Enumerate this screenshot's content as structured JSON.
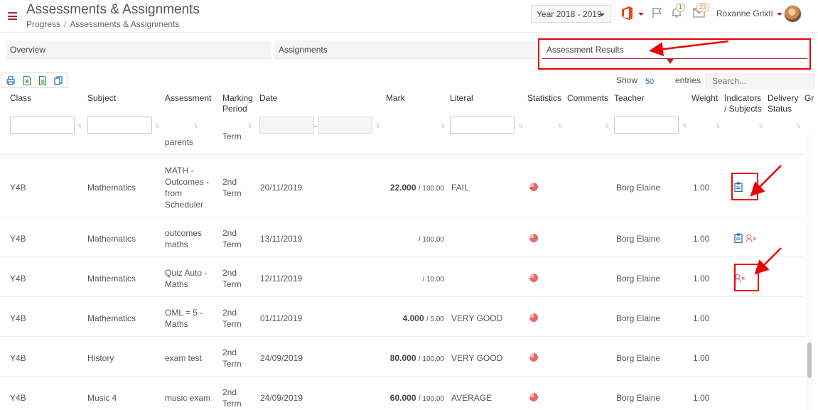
{
  "header": {
    "title": "Assessments & Assignments",
    "breadcrumb": [
      "Progress",
      "Assessments & Assignments"
    ],
    "year_select": "Year 2018 - 2019",
    "notifications_count": "1",
    "messages_count": "22",
    "user_name": "Roxanne Grixti",
    "brand_color": "#b7222b"
  },
  "tabs": [
    {
      "label": "Overview"
    },
    {
      "label": "Assignments"
    },
    {
      "label": "Assessment Results",
      "active": true
    }
  ],
  "toolbar": {
    "export_icons": [
      "print-icon",
      "excel-icon",
      "csv-icon",
      "copy-icon"
    ],
    "show_label": "Show",
    "show_value": "50",
    "entries_label": "entries",
    "search_placeholder": "Search..."
  },
  "columns": [
    "Class",
    "Subject",
    "Assessment",
    "Marking Period",
    "Date",
    "Mark",
    "Literal",
    "Statistics",
    "Comments",
    "Teacher",
    "Weight",
    "Indicators / Subjects",
    "Delivery Status",
    "Gr"
  ],
  "partial_row": {
    "assessment": "parents",
    "period": "Term"
  },
  "rows": [
    {
      "class": "Y4B",
      "subject": "Mathematics",
      "assessment": [
        "MATH -",
        "Outcomes -",
        "from",
        "Scheduler"
      ],
      "period": [
        "2nd",
        "Term"
      ],
      "date": "20/11/2019",
      "mark": "22.000",
      "mark_total": "/ 100.00",
      "literal": "FAIL",
      "teacher": "Borg Elaine",
      "weight": "1.00",
      "indicators": [
        "clipboard-icon"
      ]
    },
    {
      "class": "Y4B",
      "subject": "Mathematics",
      "assessment": [
        "outcomes",
        "maths"
      ],
      "period": [
        "2nd",
        "Term"
      ],
      "date": "13/11/2019",
      "mark": "",
      "mark_total": "/ 100.00",
      "literal": "",
      "teacher": "Borg Elaine",
      "weight": "1.00",
      "indicators": [
        "clipboard-icon",
        "user-x-icon"
      ]
    },
    {
      "class": "Y4B",
      "subject": "Mathematics",
      "assessment": [
        "Quiz Auto -",
        "Maths"
      ],
      "period": [
        "2nd",
        "Term"
      ],
      "date": "12/11/2019",
      "mark": "",
      "mark_total": "/ 10.00",
      "literal": "",
      "teacher": "Borg Elaine",
      "weight": "1.00",
      "indicators": [
        "user-x-icon"
      ]
    },
    {
      "class": "Y4B",
      "subject": "Mathematics",
      "assessment": [
        "OML = 5 -",
        "Maths"
      ],
      "period": [
        "2nd",
        "Term"
      ],
      "date": "01/11/2019",
      "mark": "4.000",
      "mark_total": "/ 5.00",
      "literal": "VERY GOOD",
      "teacher": "Borg Elaine",
      "weight": "1.00",
      "indicators": []
    },
    {
      "class": "Y4B",
      "subject": "History",
      "assessment": [
        "exam test"
      ],
      "period": [
        "2nd",
        "Term"
      ],
      "date": "24/09/2019",
      "mark": "80.000",
      "mark_total": "/ 100.00",
      "literal": "VERY GOOD",
      "teacher": "Borg Elaine",
      "weight": "1.00",
      "indicators": []
    },
    {
      "class": "Y4B",
      "subject": "Music 4",
      "assessment": [
        "music exam"
      ],
      "period": [
        "2nd",
        "Term"
      ],
      "date": "24/09/2019",
      "mark": "60.000",
      "mark_total": "/ 100.00",
      "literal": "AVERAGE",
      "teacher": "Borg Elaine",
      "weight": "1.00",
      "indicators": []
    }
  ],
  "annotation_color": "#e00000"
}
